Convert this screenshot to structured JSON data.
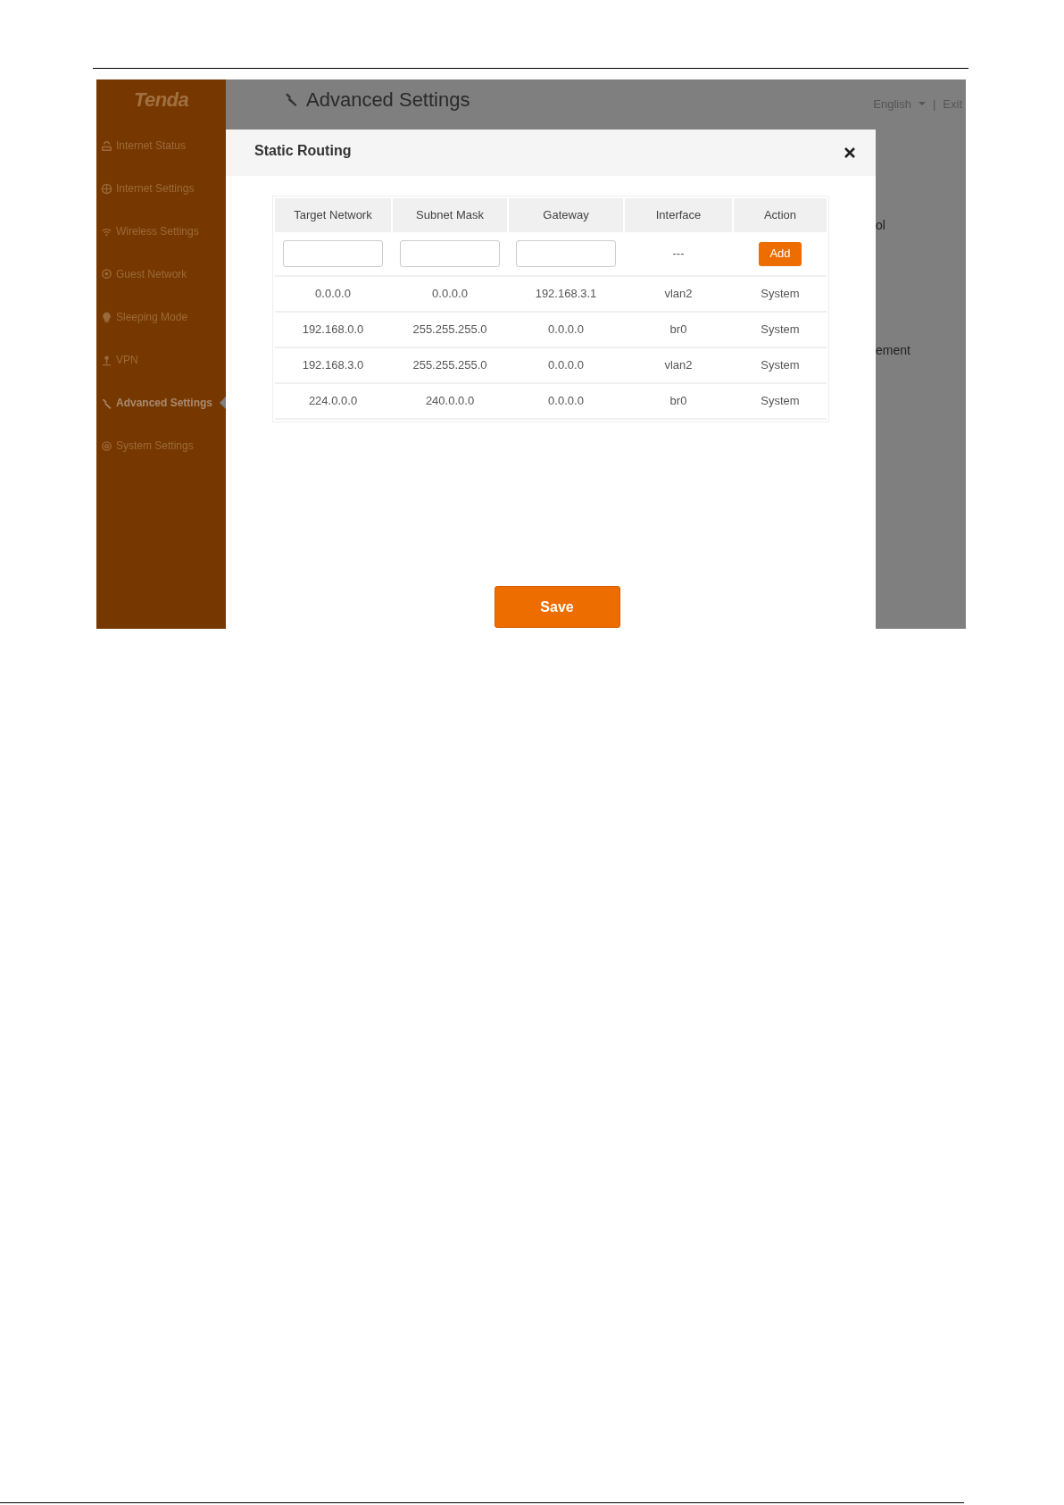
{
  "sidebar": {
    "logo": "Tenda",
    "items": [
      {
        "label": "Internet Status",
        "selected": false
      },
      {
        "label": "Internet Settings",
        "selected": false
      },
      {
        "label": "Wireless Settings",
        "selected": false
      },
      {
        "label": "Guest Network",
        "selected": false
      },
      {
        "label": "Sleeping Mode",
        "selected": false
      },
      {
        "label": "VPN",
        "selected": false
      },
      {
        "label": "Advanced Settings",
        "selected": true
      },
      {
        "label": "System Settings",
        "selected": false
      }
    ]
  },
  "header": {
    "title": "Advanced Settings",
    "language": "English",
    "separator": "|",
    "exit": "Exit"
  },
  "background_fragments": [
    "ol",
    "ement"
  ],
  "dialog": {
    "title": "Static Routing",
    "table": {
      "columns": [
        "Target Network",
        "Subnet Mask",
        "Gateway",
        "Interface",
        "Action"
      ],
      "input_row": {
        "interface": "---",
        "action": "Add"
      },
      "rows": [
        [
          "0.0.0.0",
          "0.0.0.0",
          "192.168.3.1",
          "vlan2",
          "System"
        ],
        [
          "192.168.0.0",
          "255.255.255.0",
          "0.0.0.0",
          "br0",
          "System"
        ],
        [
          "192.168.3.0",
          "255.255.255.0",
          "0.0.0.0",
          "vlan2",
          "System"
        ],
        [
          "224.0.0.0",
          "240.0.0.0",
          "0.0.0.0",
          "br0",
          "System"
        ]
      ]
    },
    "save": "Save"
  }
}
